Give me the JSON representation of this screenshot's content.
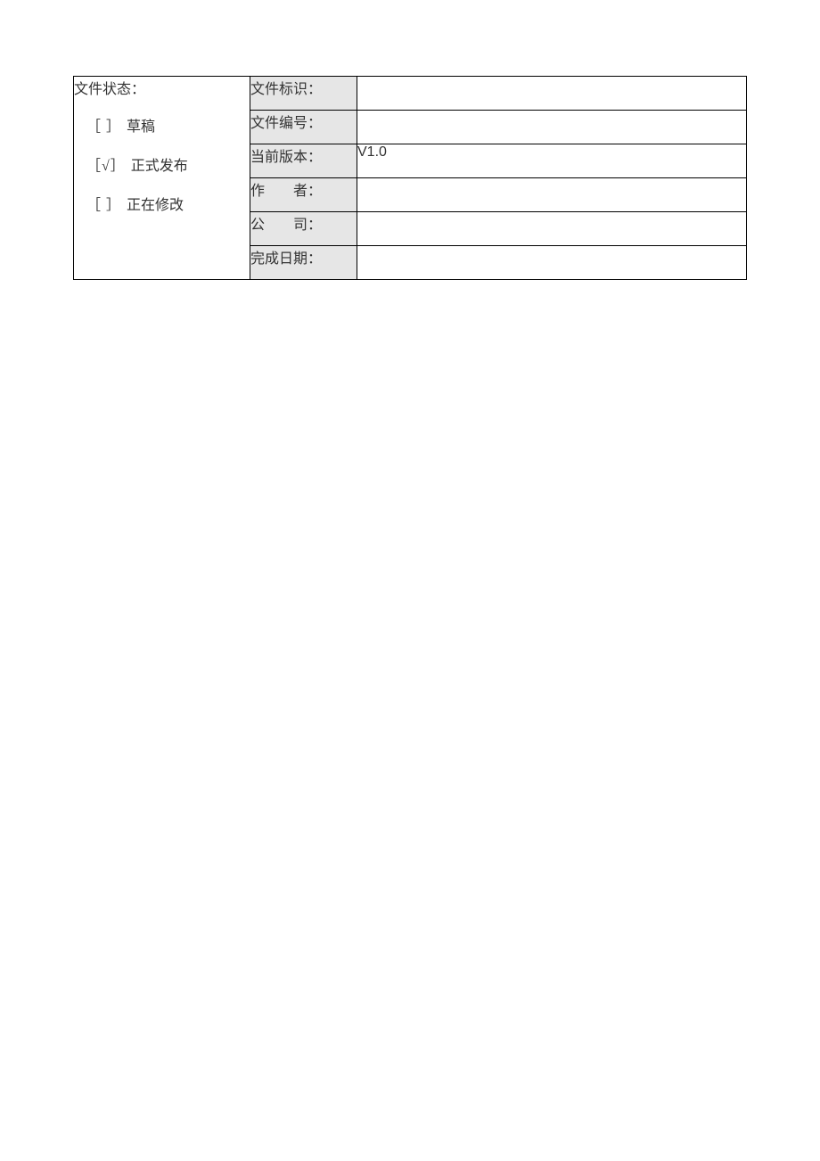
{
  "status": {
    "header": "文件状态：",
    "options": {
      "draft": {
        "mark": "［  ］",
        "label": "草稿"
      },
      "published": {
        "mark": "［√］",
        "label": "正式发布"
      },
      "modifying": {
        "mark": "［  ］",
        "label": "正在修改"
      }
    }
  },
  "fields": {
    "identifier": {
      "label": "文件标识：",
      "value": ""
    },
    "number": {
      "label": "文件编号：",
      "value": ""
    },
    "version": {
      "label": "当前版本：",
      "value": "V1.0"
    },
    "author": {
      "label": "作　　者：",
      "value": ""
    },
    "company": {
      "label": "公　　司：",
      "value": ""
    },
    "completionDate": {
      "label": "完成日期：",
      "value": ""
    }
  }
}
